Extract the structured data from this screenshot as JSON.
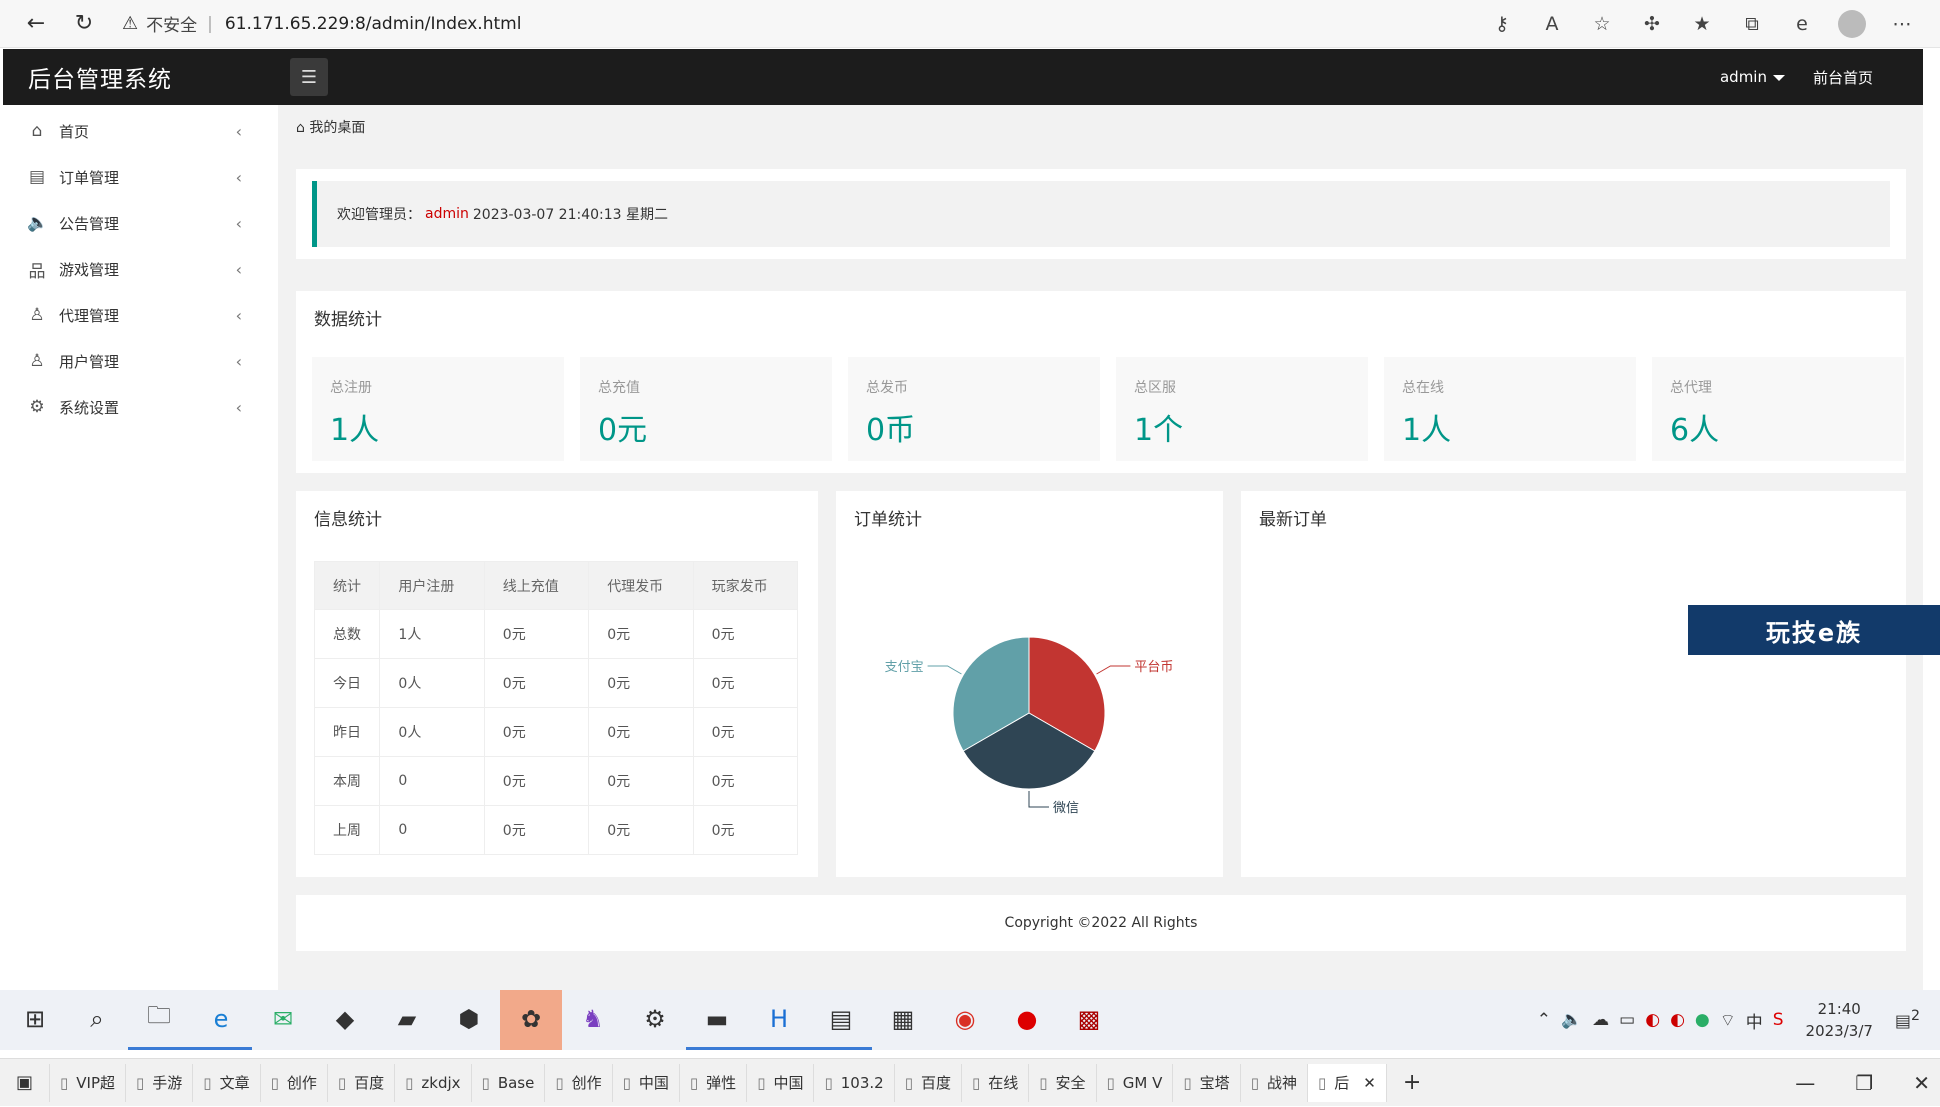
{
  "browser": {
    "insecure_label": "不安全",
    "url": "61.171.65.229:8/admin/Index.html"
  },
  "header": {
    "logo": "后台管理系统",
    "user": "admin",
    "front_link": "前台首页"
  },
  "sidebar": {
    "items": [
      {
        "label": "首页",
        "icon": "home-icon"
      },
      {
        "label": "订单管理",
        "icon": "document-icon"
      },
      {
        "label": "公告管理",
        "icon": "speaker-icon"
      },
      {
        "label": "游戏管理",
        "icon": "sitemap-icon"
      },
      {
        "label": "代理管理",
        "icon": "user-icon"
      },
      {
        "label": "用户管理",
        "icon": "user-icon"
      },
      {
        "label": "系统设置",
        "icon": "gear-icon"
      }
    ]
  },
  "breadcrumb": "我的桌面",
  "welcome": {
    "prefix": "欢迎管理员：",
    "user": "admin",
    "datetime": "2023-03-07  21:40:13  星期二"
  },
  "stats": {
    "title": "数据统计",
    "items": [
      {
        "label": "总注册",
        "value": "1人"
      },
      {
        "label": "总充值",
        "value": "0元"
      },
      {
        "label": "总发币",
        "value": "0币"
      },
      {
        "label": "总区服",
        "value": "1个"
      },
      {
        "label": "总在线",
        "value": "1人"
      },
      {
        "label": "总代理",
        "value": "6人"
      }
    ]
  },
  "info": {
    "title": "信息统计",
    "headers": [
      "统计",
      "用户注册",
      "线上充值",
      "代理发币",
      "玩家发币"
    ],
    "rows": [
      [
        "总数",
        "1人",
        "0元",
        "0元",
        "0元"
      ],
      [
        "今日",
        "0人",
        "0元",
        "0元",
        "0元"
      ],
      [
        "昨日",
        "0人",
        "0元",
        "0元",
        "0元"
      ],
      [
        "本周",
        "0",
        "0元",
        "0元",
        "0元"
      ],
      [
        "上周",
        "0",
        "0元",
        "0元",
        "0元"
      ]
    ]
  },
  "orders_chart": {
    "title": "订单统计"
  },
  "chart_data": {
    "type": "pie",
    "slices": [
      {
        "name": "平台币",
        "value": 1,
        "color": "#c23531"
      },
      {
        "name": "微信",
        "value": 1,
        "color": "#2f4554"
      },
      {
        "name": "支付宝",
        "value": 1,
        "color": "#61a0a8"
      }
    ]
  },
  "latest_orders": {
    "title": "最新订单"
  },
  "footer": "Copyright ©2022 All Rights",
  "overlay_banner": "玩技e族",
  "taskbar": {
    "time": "21:40",
    "date": "2023/3/7",
    "notif_count": "2"
  },
  "tabs": [
    "VIP超",
    "手游",
    "文章",
    "创作",
    "百度",
    "zkdjx",
    "Base",
    "创作",
    "中国",
    "弹性",
    "中国",
    "103.2",
    "百度",
    "在线",
    "安全",
    "GM V",
    "宝塔",
    "战神",
    "后"
  ]
}
